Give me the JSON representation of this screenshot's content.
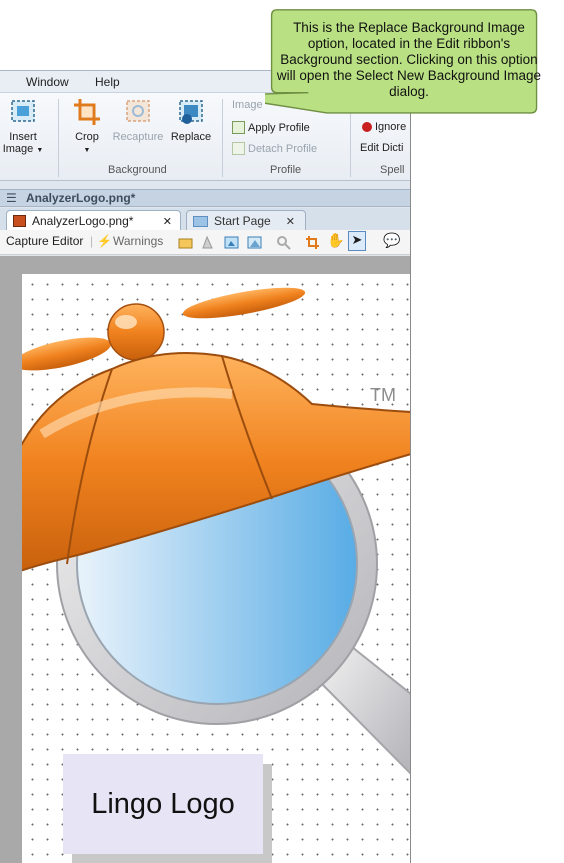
{
  "menu": [
    "Window",
    "Help"
  ],
  "ribbon": {
    "insert_image": "Insert\nImage",
    "crop": "Crop",
    "recapture": "Recapture",
    "replace": "Replace",
    "background_group": "Background",
    "image_label": "Image",
    "apply_profile": "Apply Profile",
    "detach_profile": "Detach Profile",
    "profile_group": "Profile",
    "ignore": "Ignore",
    "edit_dictionary": "Edit Dicti",
    "spell_group": "Spell"
  },
  "window_title": "AnalyzerLogo.png*",
  "tabs": [
    {
      "label": "AnalyzerLogo.png*",
      "active": true
    },
    {
      "label": "Start Page",
      "active": false
    }
  ],
  "toolbar": {
    "capture_editor": "Capture Editor",
    "warnings": "Warnings"
  },
  "canvas": {
    "tm": "TM",
    "logo_text": "Lingo Logo"
  },
  "callout": {
    "text": "This is the Replace Background Image option, located in the Edit ribbon's Background section. Clicking on this option will open the Select New Background Image dialog."
  },
  "colors": {
    "orange": "#f0821e",
    "callout_fill": "#b7e07e",
    "lens_blue": "#5aaee6"
  }
}
